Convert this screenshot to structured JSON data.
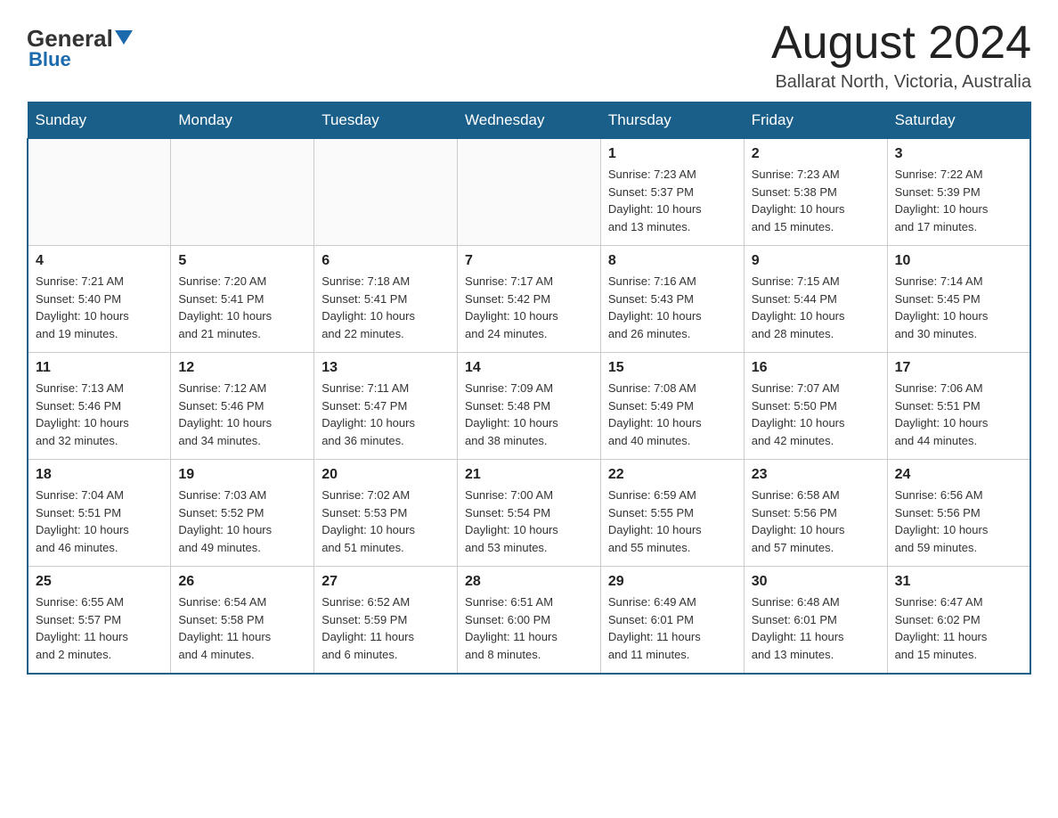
{
  "header": {
    "logo_general": "General",
    "logo_blue": "Blue",
    "title": "August 2024",
    "subtitle": "Ballarat North, Victoria, Australia"
  },
  "days_of_week": [
    "Sunday",
    "Monday",
    "Tuesday",
    "Wednesday",
    "Thursday",
    "Friday",
    "Saturday"
  ],
  "weeks": [
    [
      {
        "num": "",
        "info": ""
      },
      {
        "num": "",
        "info": ""
      },
      {
        "num": "",
        "info": ""
      },
      {
        "num": "",
        "info": ""
      },
      {
        "num": "1",
        "info": "Sunrise: 7:23 AM\nSunset: 5:37 PM\nDaylight: 10 hours\nand 13 minutes."
      },
      {
        "num": "2",
        "info": "Sunrise: 7:23 AM\nSunset: 5:38 PM\nDaylight: 10 hours\nand 15 minutes."
      },
      {
        "num": "3",
        "info": "Sunrise: 7:22 AM\nSunset: 5:39 PM\nDaylight: 10 hours\nand 17 minutes."
      }
    ],
    [
      {
        "num": "4",
        "info": "Sunrise: 7:21 AM\nSunset: 5:40 PM\nDaylight: 10 hours\nand 19 minutes."
      },
      {
        "num": "5",
        "info": "Sunrise: 7:20 AM\nSunset: 5:41 PM\nDaylight: 10 hours\nand 21 minutes."
      },
      {
        "num": "6",
        "info": "Sunrise: 7:18 AM\nSunset: 5:41 PM\nDaylight: 10 hours\nand 22 minutes."
      },
      {
        "num": "7",
        "info": "Sunrise: 7:17 AM\nSunset: 5:42 PM\nDaylight: 10 hours\nand 24 minutes."
      },
      {
        "num": "8",
        "info": "Sunrise: 7:16 AM\nSunset: 5:43 PM\nDaylight: 10 hours\nand 26 minutes."
      },
      {
        "num": "9",
        "info": "Sunrise: 7:15 AM\nSunset: 5:44 PM\nDaylight: 10 hours\nand 28 minutes."
      },
      {
        "num": "10",
        "info": "Sunrise: 7:14 AM\nSunset: 5:45 PM\nDaylight: 10 hours\nand 30 minutes."
      }
    ],
    [
      {
        "num": "11",
        "info": "Sunrise: 7:13 AM\nSunset: 5:46 PM\nDaylight: 10 hours\nand 32 minutes."
      },
      {
        "num": "12",
        "info": "Sunrise: 7:12 AM\nSunset: 5:46 PM\nDaylight: 10 hours\nand 34 minutes."
      },
      {
        "num": "13",
        "info": "Sunrise: 7:11 AM\nSunset: 5:47 PM\nDaylight: 10 hours\nand 36 minutes."
      },
      {
        "num": "14",
        "info": "Sunrise: 7:09 AM\nSunset: 5:48 PM\nDaylight: 10 hours\nand 38 minutes."
      },
      {
        "num": "15",
        "info": "Sunrise: 7:08 AM\nSunset: 5:49 PM\nDaylight: 10 hours\nand 40 minutes."
      },
      {
        "num": "16",
        "info": "Sunrise: 7:07 AM\nSunset: 5:50 PM\nDaylight: 10 hours\nand 42 minutes."
      },
      {
        "num": "17",
        "info": "Sunrise: 7:06 AM\nSunset: 5:51 PM\nDaylight: 10 hours\nand 44 minutes."
      }
    ],
    [
      {
        "num": "18",
        "info": "Sunrise: 7:04 AM\nSunset: 5:51 PM\nDaylight: 10 hours\nand 46 minutes."
      },
      {
        "num": "19",
        "info": "Sunrise: 7:03 AM\nSunset: 5:52 PM\nDaylight: 10 hours\nand 49 minutes."
      },
      {
        "num": "20",
        "info": "Sunrise: 7:02 AM\nSunset: 5:53 PM\nDaylight: 10 hours\nand 51 minutes."
      },
      {
        "num": "21",
        "info": "Sunrise: 7:00 AM\nSunset: 5:54 PM\nDaylight: 10 hours\nand 53 minutes."
      },
      {
        "num": "22",
        "info": "Sunrise: 6:59 AM\nSunset: 5:55 PM\nDaylight: 10 hours\nand 55 minutes."
      },
      {
        "num": "23",
        "info": "Sunrise: 6:58 AM\nSunset: 5:56 PM\nDaylight: 10 hours\nand 57 minutes."
      },
      {
        "num": "24",
        "info": "Sunrise: 6:56 AM\nSunset: 5:56 PM\nDaylight: 10 hours\nand 59 minutes."
      }
    ],
    [
      {
        "num": "25",
        "info": "Sunrise: 6:55 AM\nSunset: 5:57 PM\nDaylight: 11 hours\nand 2 minutes."
      },
      {
        "num": "26",
        "info": "Sunrise: 6:54 AM\nSunset: 5:58 PM\nDaylight: 11 hours\nand 4 minutes."
      },
      {
        "num": "27",
        "info": "Sunrise: 6:52 AM\nSunset: 5:59 PM\nDaylight: 11 hours\nand 6 minutes."
      },
      {
        "num": "28",
        "info": "Sunrise: 6:51 AM\nSunset: 6:00 PM\nDaylight: 11 hours\nand 8 minutes."
      },
      {
        "num": "29",
        "info": "Sunrise: 6:49 AM\nSunset: 6:01 PM\nDaylight: 11 hours\nand 11 minutes."
      },
      {
        "num": "30",
        "info": "Sunrise: 6:48 AM\nSunset: 6:01 PM\nDaylight: 11 hours\nand 13 minutes."
      },
      {
        "num": "31",
        "info": "Sunrise: 6:47 AM\nSunset: 6:02 PM\nDaylight: 11 hours\nand 15 minutes."
      }
    ]
  ]
}
